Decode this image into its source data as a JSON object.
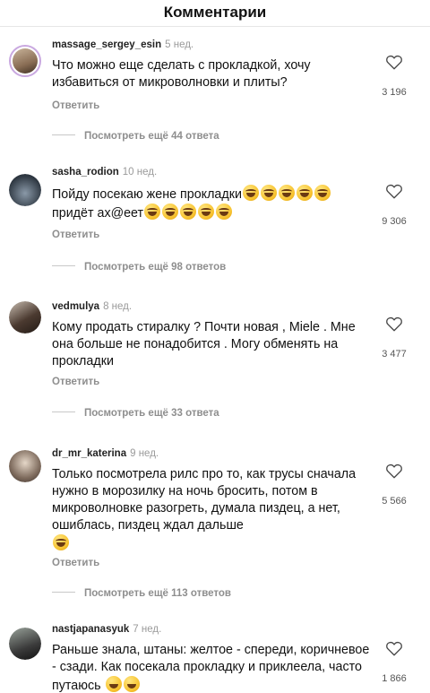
{
  "header": {
    "title": "Комментарии"
  },
  "reply_label": "Ответить",
  "comments": [
    {
      "username": "massage_sergey_esin",
      "time": "5 нед.",
      "text": "Что можно еще сделать с прокладкой, хочу избавиться от микроволновки и плиты?",
      "likes": "3 196",
      "view_replies": "Посмотреть ещё 44 ответа",
      "avatar_color": "#8a6e55"
    },
    {
      "username": "sasha_rodion",
      "time": "10 нед.",
      "text_before": "Пойду посекаю жене прокладки",
      "text_after": "придёт ах@еет",
      "emoji_count_1": 5,
      "emoji_count_2": 5,
      "likes": "9 306",
      "view_replies": "Посмотреть ещё 98 ответов",
      "avatar_color": "#2d3640"
    },
    {
      "username": "vedmulya",
      "time": "8 нед.",
      "text": "Кому продать стиралку ? Почти новая , Miele . Мне она больше не понадобится . Могу обменять на прокладки",
      "likes": "3 477",
      "view_replies": "Посмотреть ещё 33 ответа",
      "avatar_color": "#4b3a30"
    },
    {
      "username": "dr_mr_katerina",
      "time": "9 нед.",
      "text": "Только посмотрела рилс про то, как трусы сначала нужно в морозилку на ночь бросить, потом в микроволновке разогреть, думала пиздец, а нет, ошиблась, пиздец  ждал дальше",
      "likes": "5 566",
      "view_replies": "Посмотреть ещё 113 ответов",
      "avatar_color": "#7d6a5c"
    },
    {
      "username": "nastjapanasyuk",
      "time": "7 нед.",
      "text": "Раньше знала, штаны: желтое - спереди, коричневое - сзади. Как посекала прокладку и приклеела, часто путаюсь",
      "likes": "1 866",
      "avatar_color": "#3b3b3b"
    }
  ],
  "icons": {
    "like": "heart-outline-icon",
    "emoji": "laughing-emoji-icon"
  }
}
